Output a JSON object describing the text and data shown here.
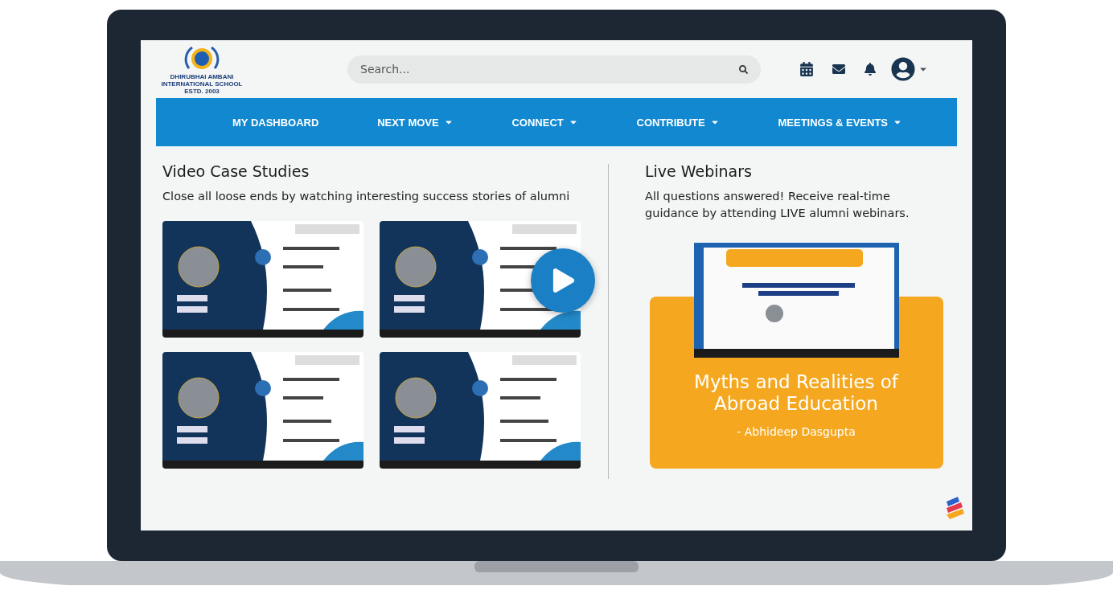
{
  "logo": {
    "lines": [
      "DHIRUBHAI AMBANI",
      "INTERNATIONAL SCHOOL",
      "ESTD. 2003"
    ]
  },
  "search": {
    "placeholder": "Search..."
  },
  "nav": [
    {
      "label": "MY DASHBOARD",
      "has_menu": false
    },
    {
      "label": "NEXT MOVE",
      "has_menu": true
    },
    {
      "label": "CONNECT",
      "has_menu": true
    },
    {
      "label": "CONTRIBUTE",
      "has_menu": true
    },
    {
      "label": "MEETINGS & EVENTS",
      "has_menu": true
    }
  ],
  "video_case_studies": {
    "title": "Video Case Studies",
    "subtitle": "Close all loose ends by watching interesting success stories of alumni",
    "videos": [
      {
        "play_overlay": false
      },
      {
        "play_overlay": true
      },
      {
        "play_overlay": false
      },
      {
        "play_overlay": false
      }
    ]
  },
  "live_webinars": {
    "title": "Live Webinars",
    "subtitle": "All questions answered! Receive real-time guidance by attending LIVE alumni webinars.",
    "card": {
      "title": "Myths and Realities of Abroad Education",
      "speaker": "- Abhideep Dasgupta"
    }
  }
}
